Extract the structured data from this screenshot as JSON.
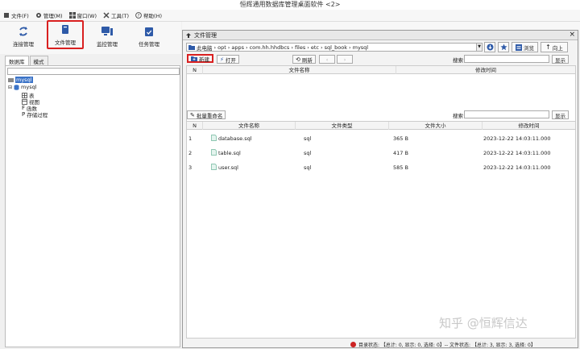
{
  "window": {
    "title": "恒辉通用数据库管理桌面软件 <2>"
  },
  "menu": [
    {
      "label": "文件(F)",
      "icon": "file-icon"
    },
    {
      "label": "管理(M)",
      "icon": "gear-icon"
    },
    {
      "label": "窗口(W)",
      "icon": "windows-icon"
    },
    {
      "label": "工具(T)",
      "icon": "tools-icon"
    },
    {
      "label": "帮助(H)",
      "icon": "help-icon"
    }
  ],
  "toolbar": {
    "connect": "连接管理",
    "files": "文件管理",
    "monitor": "监控管理",
    "tasks": "任务管理"
  },
  "left": {
    "tabs": [
      "数据库",
      "模式"
    ],
    "tree": {
      "root": "mysql",
      "schema": "mysql",
      "children": [
        "表",
        "视图",
        "函数",
        "存储过程"
      ]
    }
  },
  "fm": {
    "title": "文件管理",
    "path": [
      "此电脑",
      "opt",
      "apps",
      "com.hh.hhdbcs",
      "files",
      "etc",
      "sql_book",
      "mysql"
    ],
    "browse": "浏览",
    "up": "向上",
    "new": "新建",
    "open": "打开",
    "refresh": "刷新",
    "search_label": "搜索",
    "show": "显示",
    "top_grid": {
      "cols": [
        "N",
        "文件名称",
        "修改时间"
      ]
    },
    "batch_rename": "批量重命名",
    "search_label2": "搜索",
    "show2": "显示",
    "bottom_grid": {
      "cols": [
        "N",
        "文件名称",
        "文件类型",
        "文件大小",
        "修改时间"
      ],
      "rows": [
        {
          "n": "1",
          "name": "database.sql",
          "type": "sql",
          "size": "365 B",
          "time": "2023-12-22 14:03:11.000"
        },
        {
          "n": "2",
          "name": "table.sql",
          "type": "sql",
          "size": "417 B",
          "time": "2023-12-22 14:03:11.000"
        },
        {
          "n": "3",
          "name": "user.sql",
          "type": "sql",
          "size": "585 B",
          "time": "2023-12-22 14:03:11.000"
        }
      ]
    },
    "status": "目录状态: 【总计: 0, 显示: 0, 选择: 0】-- 文件状态: 【总计: 3, 显示: 3, 选择: 0】"
  },
  "watermark": "知乎 @恒辉信达",
  "colors": {
    "highlight": "#d92020",
    "selection": "#3b73c7",
    "status_dot": "#cc2222"
  }
}
